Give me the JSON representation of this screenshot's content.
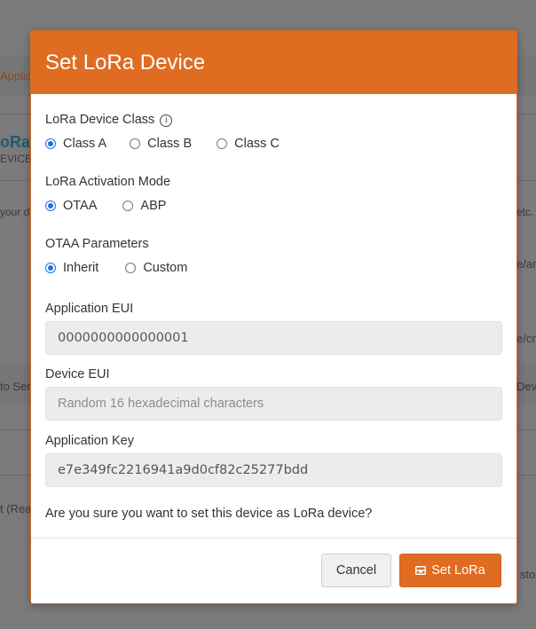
{
  "background": {
    "fragments": [
      "Applic",
      "oRa",
      "EVICE",
      "your d",
      "etc.",
      "e/ar",
      "e/cr",
      "to Sen",
      "Dev",
      "t (Rea",
      "sto"
    ]
  },
  "modal": {
    "title": "Set LoRa Device",
    "device_class": {
      "label": "LoRa Device Class",
      "options": [
        "Class A",
        "Class B",
        "Class C"
      ],
      "selected": "Class A"
    },
    "activation_mode": {
      "label": "LoRa Activation Mode",
      "options": [
        "OTAA",
        "ABP"
      ],
      "selected": "OTAA"
    },
    "otaa_parameters": {
      "label": "OTAA Parameters",
      "options": [
        "Inherit",
        "Custom"
      ],
      "selected": "Inherit"
    },
    "application_eui": {
      "label": "Application EUI",
      "value": "0000000000000001"
    },
    "device_eui": {
      "label": "Device EUI",
      "placeholder": "Random 16 hexadecimal characters"
    },
    "application_key": {
      "label": "Application Key",
      "value": "e7e349fc2216941a9d0cf82c25277bdd"
    },
    "confirm_text": "Are you sure you want to set this device as LoRa device?",
    "cancel_label": "Cancel",
    "submit_label": "Set LoRa"
  },
  "colors": {
    "accent": "#e06c22",
    "radio_checked": "#1a73e8"
  }
}
